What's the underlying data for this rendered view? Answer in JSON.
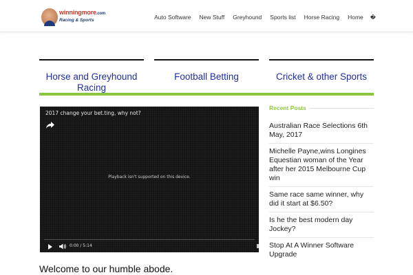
{
  "logo": {
    "word": "winningmore",
    "dotcom": ".com",
    "tagline": "Racing  & Sports"
  },
  "nav": {
    "items": [
      "Auto Software",
      "New Stuff",
      "Greyhound",
      "Sports list",
      "Horse Racing",
      "Home"
    ],
    "extra_glyph": "�"
  },
  "categories": [
    "Horse and Greyhound Racing",
    "Football Betting",
    "Cricket & other Sports"
  ],
  "video": {
    "title": "2017 change your bet.ting, why not?",
    "message": "Playback isn't supported on this device.",
    "time": "0:00 / 5:14"
  },
  "recent_posts": {
    "heading": "Recent Posts",
    "items": [
      "Australian Race Selections 6th May, 2017",
      "Michelle Payne,wins Longines Equestian woman of the Year after her 2015 Melbourne Cup win",
      "Same race same winner, why did it start at $6.50?",
      "Is he the best modern day Jockey?",
      "Stop At A Winner Software Upgrade"
    ]
  },
  "main": {
    "welcome": "Welcome to our humble abode."
  },
  "colors": {
    "accent_green": "#8cc63f",
    "link_blue": "#1f2fa0"
  }
}
